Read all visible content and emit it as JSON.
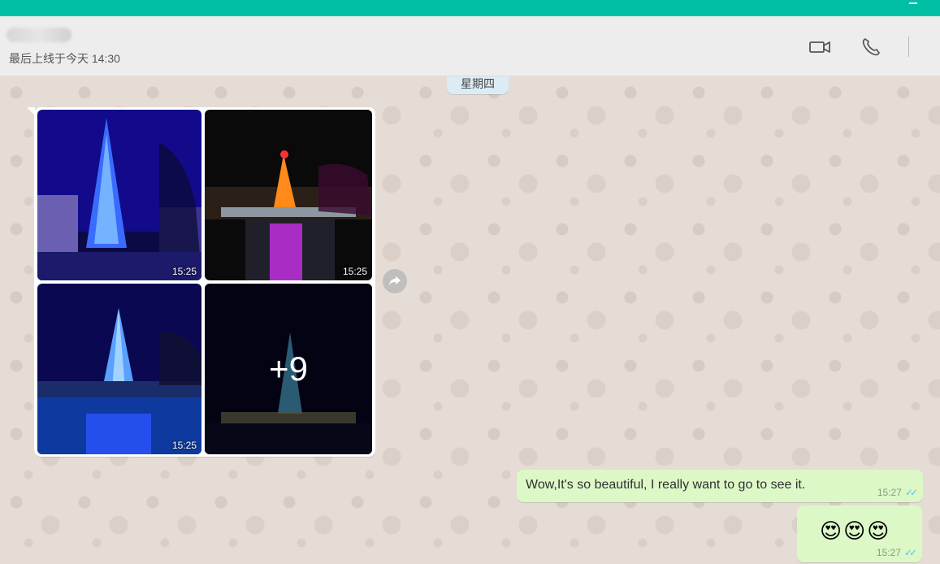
{
  "header": {
    "status": "最后上线于今天 14:30",
    "icons": [
      "video-call-icon",
      "phone-call-icon"
    ]
  },
  "chat": {
    "date_separator": "星期四",
    "album": {
      "photos": [
        {
          "time": "15:25"
        },
        {
          "time": "15:25"
        },
        {
          "time": "15:25"
        },
        {
          "more": "+9"
        }
      ]
    },
    "outgoing": [
      {
        "text": "Wow,It's so beautiful, I really want to go to see it.",
        "time": "15:27"
      },
      {
        "text": "😍😍😍",
        "time": "15:27"
      }
    ]
  },
  "colors": {
    "accent": "#00bfa5",
    "outgoing_bubble": "#dcf8c6",
    "chat_bg": "#e5ddd5",
    "read_ticks": "#4fc3f7"
  }
}
